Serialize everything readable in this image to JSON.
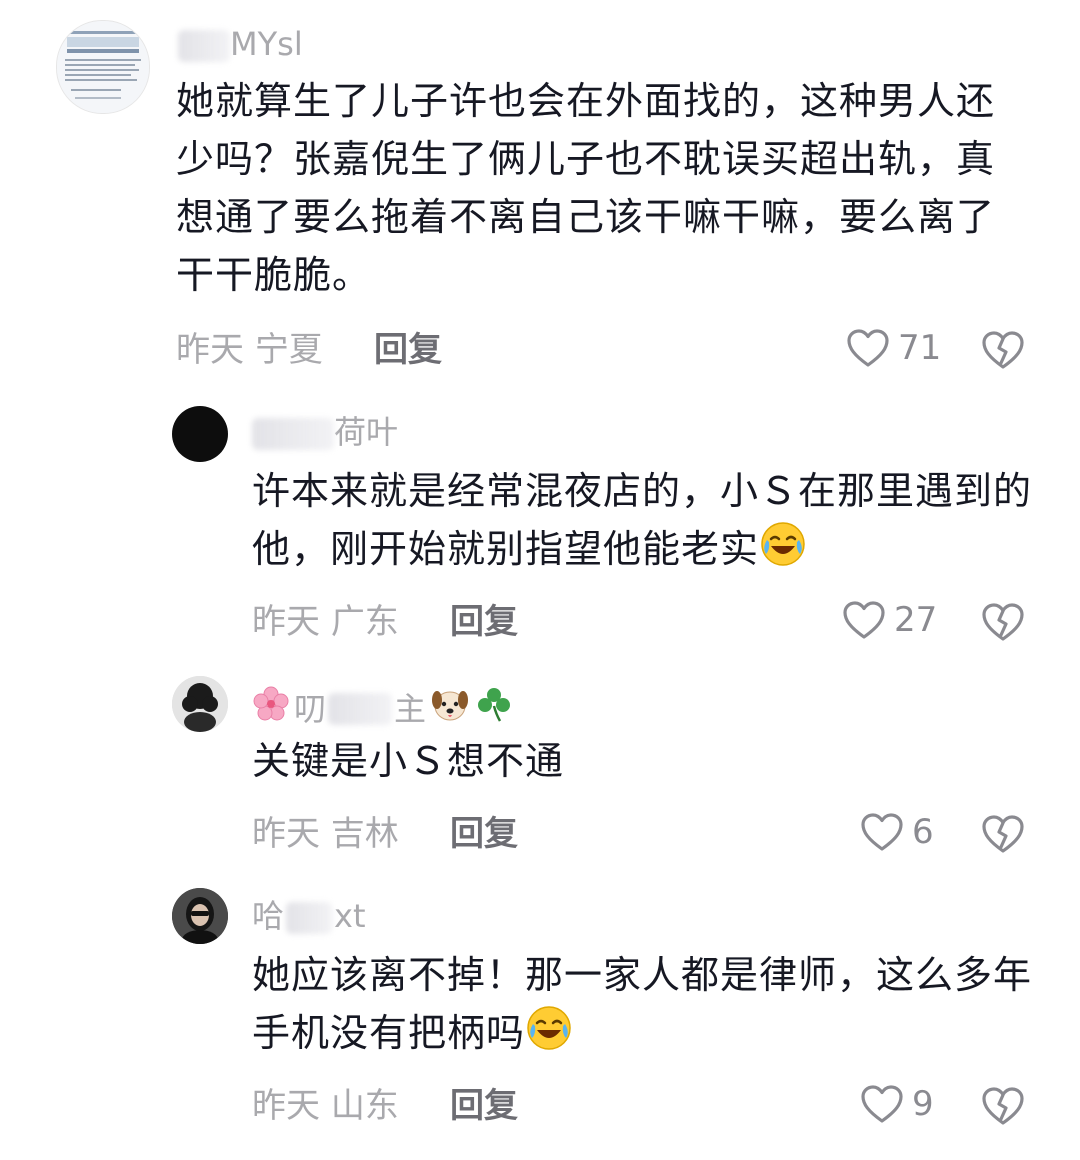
{
  "comments": [
    {
      "username_visible": "MYsl",
      "text": "她就算生了儿子许也会在外面找的，这种男人还少吗？张嘉倪生了俩儿子也不耽误买超出轨，真想通了要么拖着不离自己该干嘛干嘛，要么离了干干脆脆。",
      "time": "昨天",
      "location": "宁夏",
      "reply_label": "回复",
      "likes": "71"
    },
    {
      "username_visible": "荷叶",
      "text": "许本来就是经常混夜店的，小Ｓ在那里遇到的他，刚开始就别指望他能老实",
      "time": "昨天",
      "location": "广东",
      "reply_label": "回复",
      "likes": "27"
    },
    {
      "username_visible_a": "叨",
      "username_visible_b": "主",
      "text": "关键是小Ｓ想不通",
      "time": "昨天",
      "location": "吉林",
      "reply_label": "回复",
      "likes": "6"
    },
    {
      "username_visible_a": "哈",
      "username_visible_b": "xt",
      "text": "她应该离不掉！那一家人都是律师，这么多年手机没有把柄吗",
      "time": "昨天",
      "location": "山东",
      "reply_label": "回复",
      "likes": "9"
    }
  ],
  "icons": {
    "like": "heart-outline-icon",
    "dislike": "broken-heart-icon",
    "emoji_cry_laugh": "face-with-tears-of-joy-icon",
    "flower": "cherry-blossom-icon",
    "dog": "dog-face-icon",
    "clover": "shamrock-icon"
  },
  "colors": {
    "text": "#161823",
    "muted": "#a9a9ad",
    "reply": "#6d6d73"
  }
}
